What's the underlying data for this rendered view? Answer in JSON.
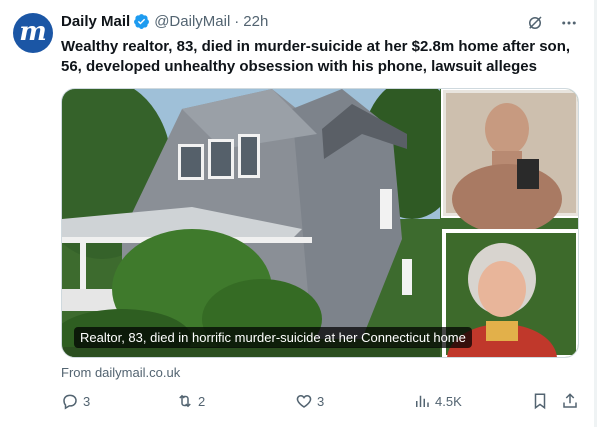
{
  "tweet": {
    "author_name": "Daily Mail",
    "handle": "@DailyMail",
    "separator": "·",
    "time": "22h",
    "avatar_letter": "m",
    "text": "Wealthy realtor, 83, died in murder-suicide at her $2.8m home after son, 56, developed unhealthy obsession with his phone, lawsuit alleges",
    "media_caption": "Realtor, 83, died in horrific murder-suicide at her Connecticut home",
    "source": "From dailymail.co.uk"
  },
  "metrics": {
    "replies": "3",
    "reposts": "2",
    "likes": "3",
    "views": "4.5K"
  },
  "icons": {
    "verified": "verified-badge-icon",
    "grok": "grok-icon",
    "more": "more-icon",
    "reply": "reply-icon",
    "repost": "repost-icon",
    "like": "heart-icon",
    "views": "views-icon",
    "bookmark": "bookmark-icon",
    "share": "share-icon"
  },
  "colors": {
    "brand_blue": "#1b56a5",
    "verified_blue": "#1d9bf0",
    "secondary_text": "#536471",
    "primary_text": "#0f1419"
  }
}
